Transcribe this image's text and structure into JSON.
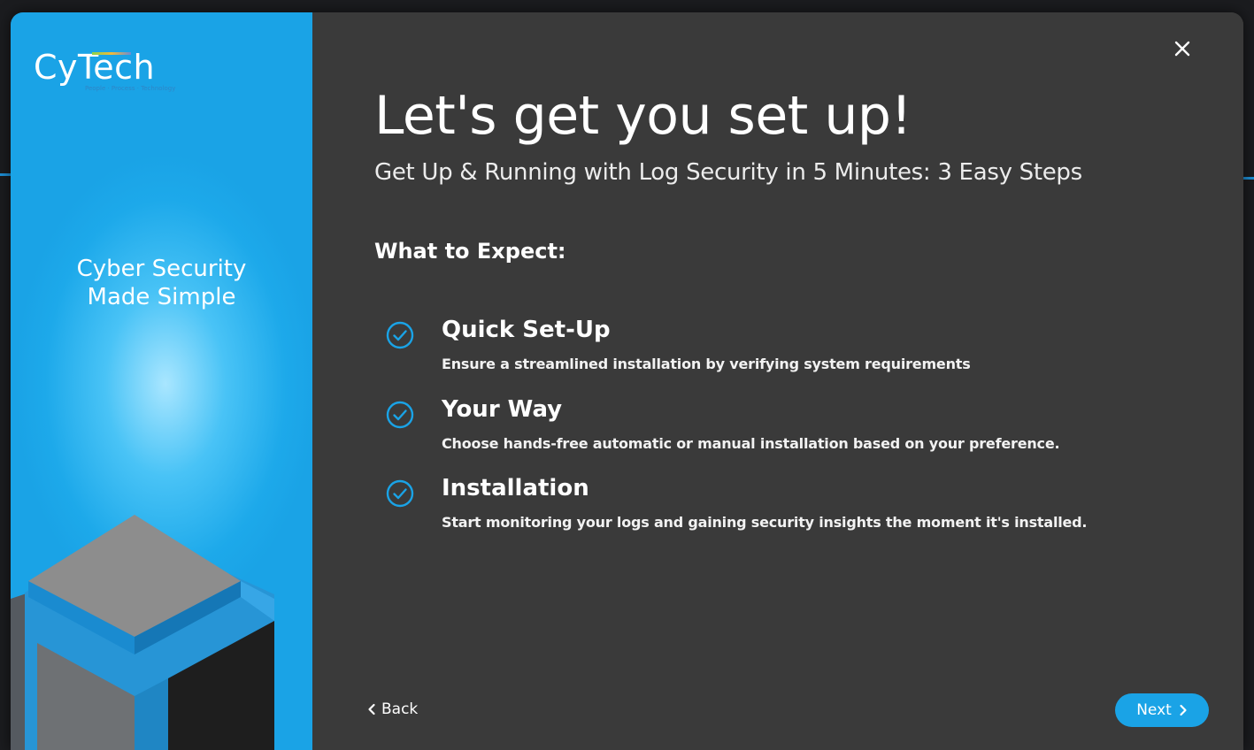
{
  "brand": {
    "name": "CyTech",
    "tagline": "People · Process · Technology"
  },
  "left_panel": {
    "tagline_line1": "Cyber Security",
    "tagline_line2": "Made Simple"
  },
  "header": {
    "title": "Let's get you set up!",
    "subtitle": "Get Up & Running with Log Security in 5 Minutes: 3 Easy Steps"
  },
  "section": {
    "heading": "What to Expect:"
  },
  "steps": [
    {
      "title": "Quick Set-Up",
      "description": "Ensure a streamlined installation by verifying system requirements"
    },
    {
      "title": "Your Way",
      "description": "Choose hands-free automatic or manual installation based on your preference."
    },
    {
      "title": "Installation",
      "description": "Start monitoring your logs and gaining security insights the moment it's installed."
    }
  ],
  "footer": {
    "back_label": "Back",
    "next_label": "Next"
  },
  "icons": {
    "close": "close-icon",
    "check": "check-circle-icon",
    "back": "chevron-left-icon",
    "next": "chevron-right-icon"
  },
  "colors": {
    "accent": "#1aa3e6",
    "panel_bg": "#3a3a3a",
    "left_panel_bg": "#1da9ea"
  }
}
